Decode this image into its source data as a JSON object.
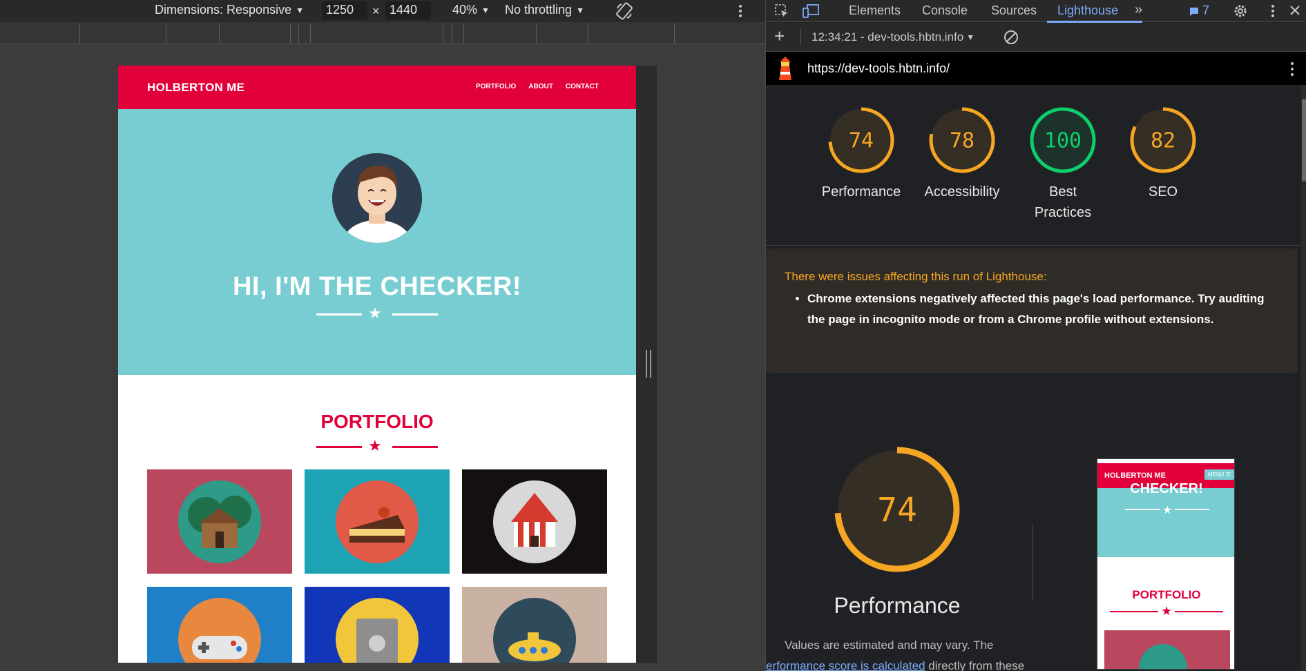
{
  "device_toolbar": {
    "dimensions_label": "Dimensions: Responsive",
    "width_value": "1250",
    "times": "×",
    "height_value": "1440",
    "zoom": "40%",
    "throttling": "No throttling"
  },
  "site": {
    "logo": "HOLBERTON ME",
    "nav": [
      "PORTFOLIO",
      "ABOUT",
      "CONTACT"
    ],
    "hero_title": "HI, I'M THE CHECKER!",
    "portfolio_title": "PORTFOLIO",
    "tile_colors": [
      "#b9485f",
      "#1ea3b4",
      "#141010",
      "#1f80c8",
      "#1236b8",
      "#c9b1a4"
    ]
  },
  "devtools": {
    "tabs": [
      "Elements",
      "Console",
      "Sources",
      "Lighthouse"
    ],
    "active_tab": "Lighthouse",
    "issues_count": "7",
    "report_selector": "12:34:21 - dev-tools.hbtn.info",
    "url": "https://dev-tools.hbtn.info/"
  },
  "scores": [
    {
      "value": 74,
      "label": "Performance",
      "color": "#f5a623"
    },
    {
      "value": 78,
      "label": "Accessibility",
      "color": "#f5a623"
    },
    {
      "value": 100,
      "label": "Best Practices",
      "color": "#0cce6b"
    },
    {
      "value": 82,
      "label": "SEO",
      "color": "#f5a623"
    }
  ],
  "warning": {
    "title": "There were issues affecting this run of Lighthouse:",
    "item": "Chrome extensions negatively affected this page's load performance. Try auditing the page in incognito mode or from a Chrome profile without extensions."
  },
  "performance": {
    "score": 74,
    "label": "Performance",
    "note_prefix": "Values are estimated and may vary. The",
    "note_link": "erformance score is calculated",
    "note_suffix": " directly from these"
  },
  "thumbnail": {
    "logo": "HOLBERTON ME",
    "menu_button": "MENU ☰",
    "hero_fragment": "CHECKER!",
    "section_title": "PORTFOLIO"
  }
}
